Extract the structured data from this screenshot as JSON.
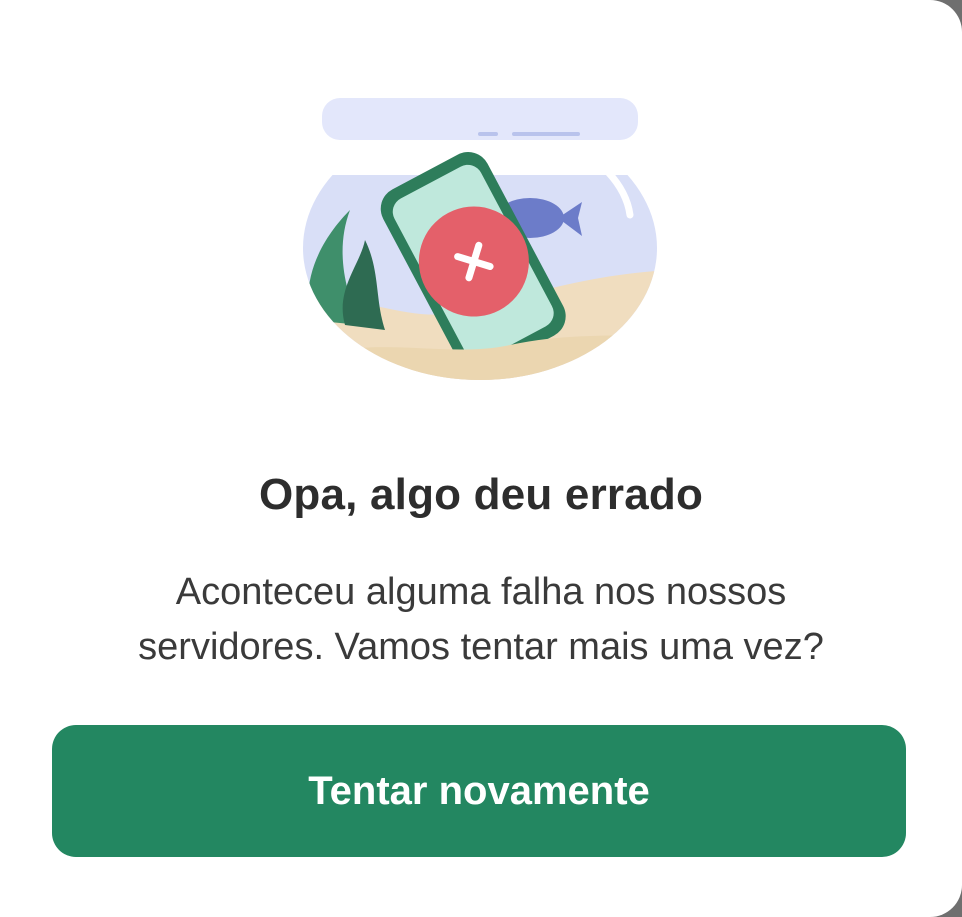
{
  "error_dialog": {
    "illustration_icon": "fishbowl-phone-error-illustration",
    "title": "Opa, algo deu errado",
    "message_line1": "Aconteceu alguma falha nos nossos",
    "message_line2": "servidores. Vamos tentar mais uma vez?",
    "retry_button_label": "Tentar novamente"
  },
  "colors": {
    "primary_button": "#238761",
    "title_text": "#2d2d2d",
    "body_text": "#3a3a3a",
    "error_red": "#e4606a",
    "phone_green": "#2e7d5b"
  }
}
